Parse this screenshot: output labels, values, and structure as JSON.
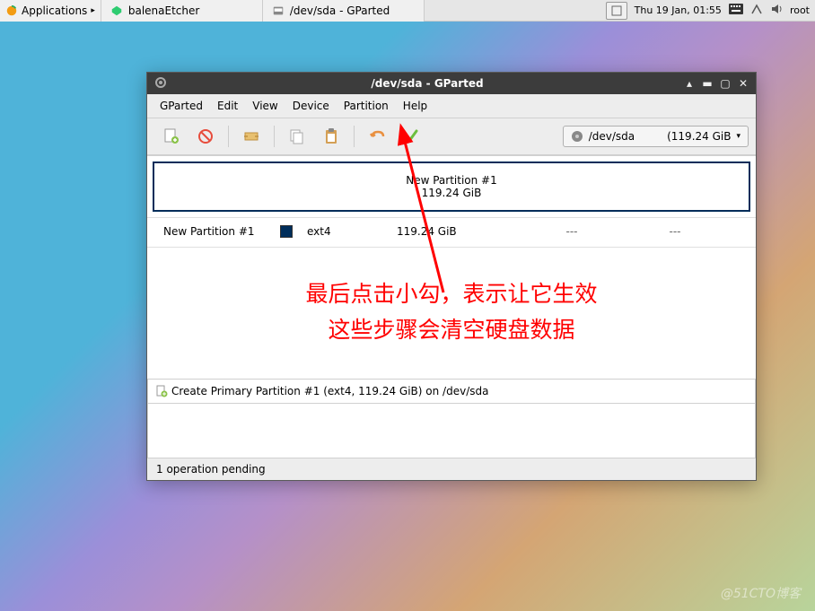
{
  "panel": {
    "applications_label": "Applications",
    "task1": "balenaEtcher",
    "task2": "/dev/sda - GParted",
    "clock": "Thu 19 Jan, 01:55",
    "user": "root"
  },
  "window": {
    "title": "/dev/sda - GParted"
  },
  "menubar": {
    "items": [
      "GParted",
      "Edit",
      "View",
      "Device",
      "Partition",
      "Help"
    ]
  },
  "device": {
    "name": "/dev/sda",
    "size": "(119.24 GiB"
  },
  "graph": {
    "name": "New Partition #1",
    "size": "119.24 GiB"
  },
  "table": {
    "name": "New Partition #1",
    "fs": "ext4",
    "size": "119.24 GiB",
    "used": "---",
    "free": "---"
  },
  "annotation": {
    "line1": "最后点击小勾，表示让它生效",
    "line2": "这些步骤会清空硬盘数据"
  },
  "pending": {
    "op": "Create Primary Partition #1 (ext4, 119.24 GiB) on /dev/sda"
  },
  "status": {
    "text": "1 operation pending"
  },
  "watermark": "@51CTO博客"
}
